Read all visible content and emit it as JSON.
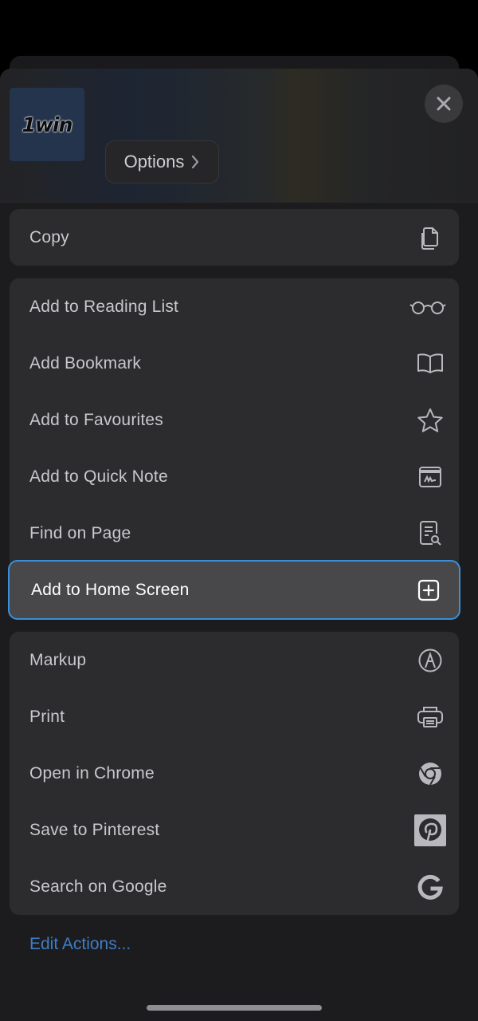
{
  "header": {
    "logo_text": "1win",
    "options_label": "Options",
    "options_chevron": ">",
    "close_icon": "close-icon"
  },
  "groups": [
    {
      "items": [
        {
          "label": "Copy",
          "icon": "copy-icon"
        }
      ]
    },
    {
      "items": [
        {
          "label": "Add to Reading List",
          "icon": "glasses-icon"
        },
        {
          "label": "Add Bookmark",
          "icon": "book-icon"
        },
        {
          "label": "Add to Favourites",
          "icon": "star-icon"
        },
        {
          "label": "Add to Quick Note",
          "icon": "quick-note-icon"
        },
        {
          "label": "Find on Page",
          "icon": "find-on-page-icon"
        },
        {
          "label": "Add to Home Screen",
          "icon": "add-square-icon",
          "highlighted": true
        }
      ]
    },
    {
      "items": [
        {
          "label": "Markup",
          "icon": "markup-icon"
        },
        {
          "label": "Print",
          "icon": "printer-icon"
        },
        {
          "label": "Open in Chrome",
          "icon": "chrome-icon"
        },
        {
          "label": "Save to Pinterest",
          "icon": "pinterest-icon"
        },
        {
          "label": "Search on Google",
          "icon": "google-icon"
        }
      ]
    }
  ],
  "edit_actions_label": "Edit Actions...",
  "colors": {
    "sheet_bg": "#1c1c1e",
    "group_bg": "#2c2c2e",
    "highlight_bg": "#48484b",
    "highlight_border": "#3a8fd8",
    "link": "#3f7dc4"
  }
}
